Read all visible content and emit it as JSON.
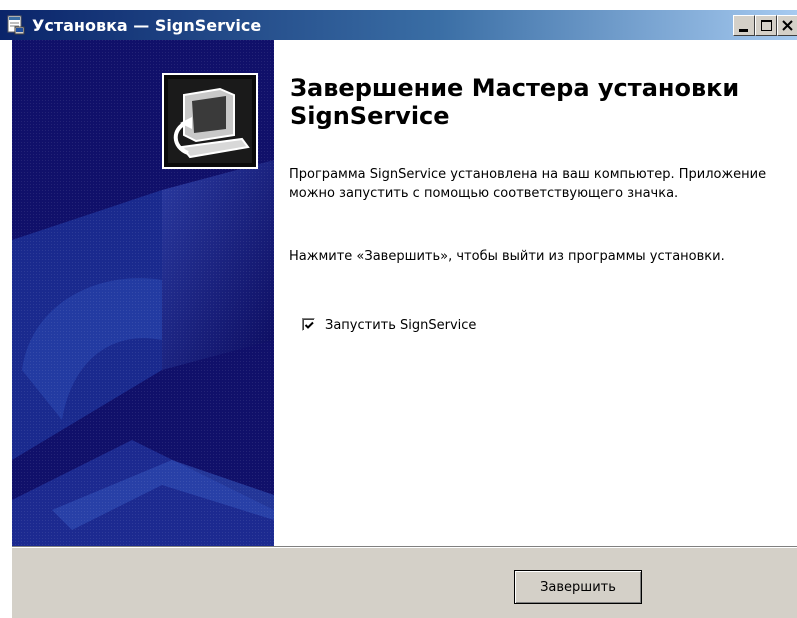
{
  "window": {
    "title": "Установка — SignService",
    "icons": {
      "app": "installer-icon",
      "minimize": "minimize-icon",
      "maximize": "maximize-icon",
      "close": "close-icon"
    }
  },
  "banner": {
    "icon": "computer-setup-icon"
  },
  "content": {
    "heading": "Завершение Мастера установки SignService",
    "paragraph1": "Программа SignService установлена на ваш компьютер. Приложение можно запустить с помощью соответствующего значка.",
    "paragraph2": "Нажмите «Завершить», чтобы выйти из программы установки.",
    "launch_checkbox": {
      "label": "Запустить SignService",
      "checked": true
    }
  },
  "footer": {
    "finish_label": "Завершить"
  },
  "colors": {
    "titlebar_start": "#0a246a",
    "titlebar_end": "#a6caf0",
    "banner_bg": "#10106a",
    "footer_bg": "#d4d0c8"
  }
}
